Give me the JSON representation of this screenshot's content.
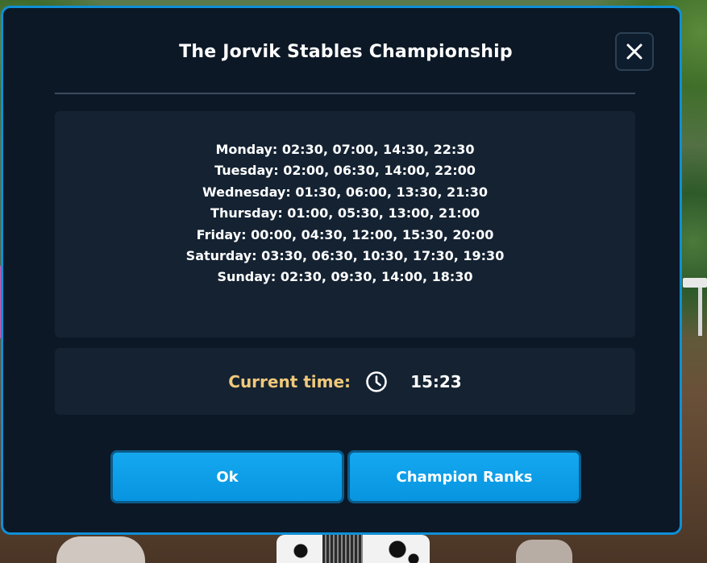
{
  "dialog": {
    "title": "The Jorvik Stables Championship",
    "close_icon": "close-x-icon"
  },
  "schedule": [
    "Monday: 02:30, 07:00, 14:30, 22:30",
    "Tuesday: 02:00, 06:30, 14:00, 22:00",
    "Wednesday: 01:30, 06:00, 13:30, 21:30",
    "Thursday: 01:00, 05:30, 13:00, 21:00",
    "Friday: 00:00, 04:30, 12:00, 15:30, 20:00",
    "Saturday: 03:30, 06:30, 10:30, 17:30, 19:30",
    "Sunday: 02:30, 09:30, 14:00, 18:30"
  ],
  "current_time": {
    "label": "Current time:",
    "icon": "clock-icon",
    "value": "15:23"
  },
  "buttons": {
    "ok": "Ok",
    "champion_ranks": "Champion Ranks"
  },
  "colors": {
    "dialog_bg": "#0c1826",
    "dialog_border": "#0f8fd6",
    "panel_bg": "#142232",
    "accent_gold": "#f0c97a",
    "button_blue": "#0f9fe8"
  }
}
